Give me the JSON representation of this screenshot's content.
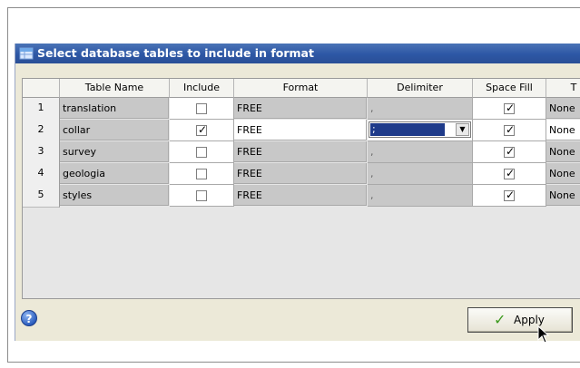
{
  "dialog": {
    "title": "Select database tables to include in format"
  },
  "table": {
    "columns": [
      "Table Name",
      "Include",
      "Format",
      "Delimiter",
      "Space Fill",
      "T"
    ],
    "rows": [
      {
        "num": "1",
        "name": "translation",
        "include": false,
        "format": "FREE",
        "delimiter": ",",
        "space_fill": true,
        "t": "None"
      },
      {
        "num": "2",
        "name": "collar",
        "include": true,
        "format": "FREE",
        "delimiter": ";",
        "space_fill": true,
        "t": "None"
      },
      {
        "num": "3",
        "name": "survey",
        "include": false,
        "format": "FREE",
        "delimiter": ",",
        "space_fill": true,
        "t": "None"
      },
      {
        "num": "4",
        "name": "geologia",
        "include": false,
        "format": "FREE",
        "delimiter": ",",
        "space_fill": true,
        "t": "None"
      },
      {
        "num": "5",
        "name": "styles",
        "include": false,
        "format": "FREE",
        "delimiter": ",",
        "space_fill": true,
        "t": "None"
      }
    ],
    "selected_row": "2"
  },
  "footer": {
    "help_icon": "?",
    "apply_label": "Apply",
    "apply_icon": "checkmark-icon"
  },
  "check_mark": "✓",
  "colors": {
    "title_bar": "#2d57a5",
    "grey_cell": "#c8c8c8",
    "selected_cell": "#1f3b8a"
  }
}
